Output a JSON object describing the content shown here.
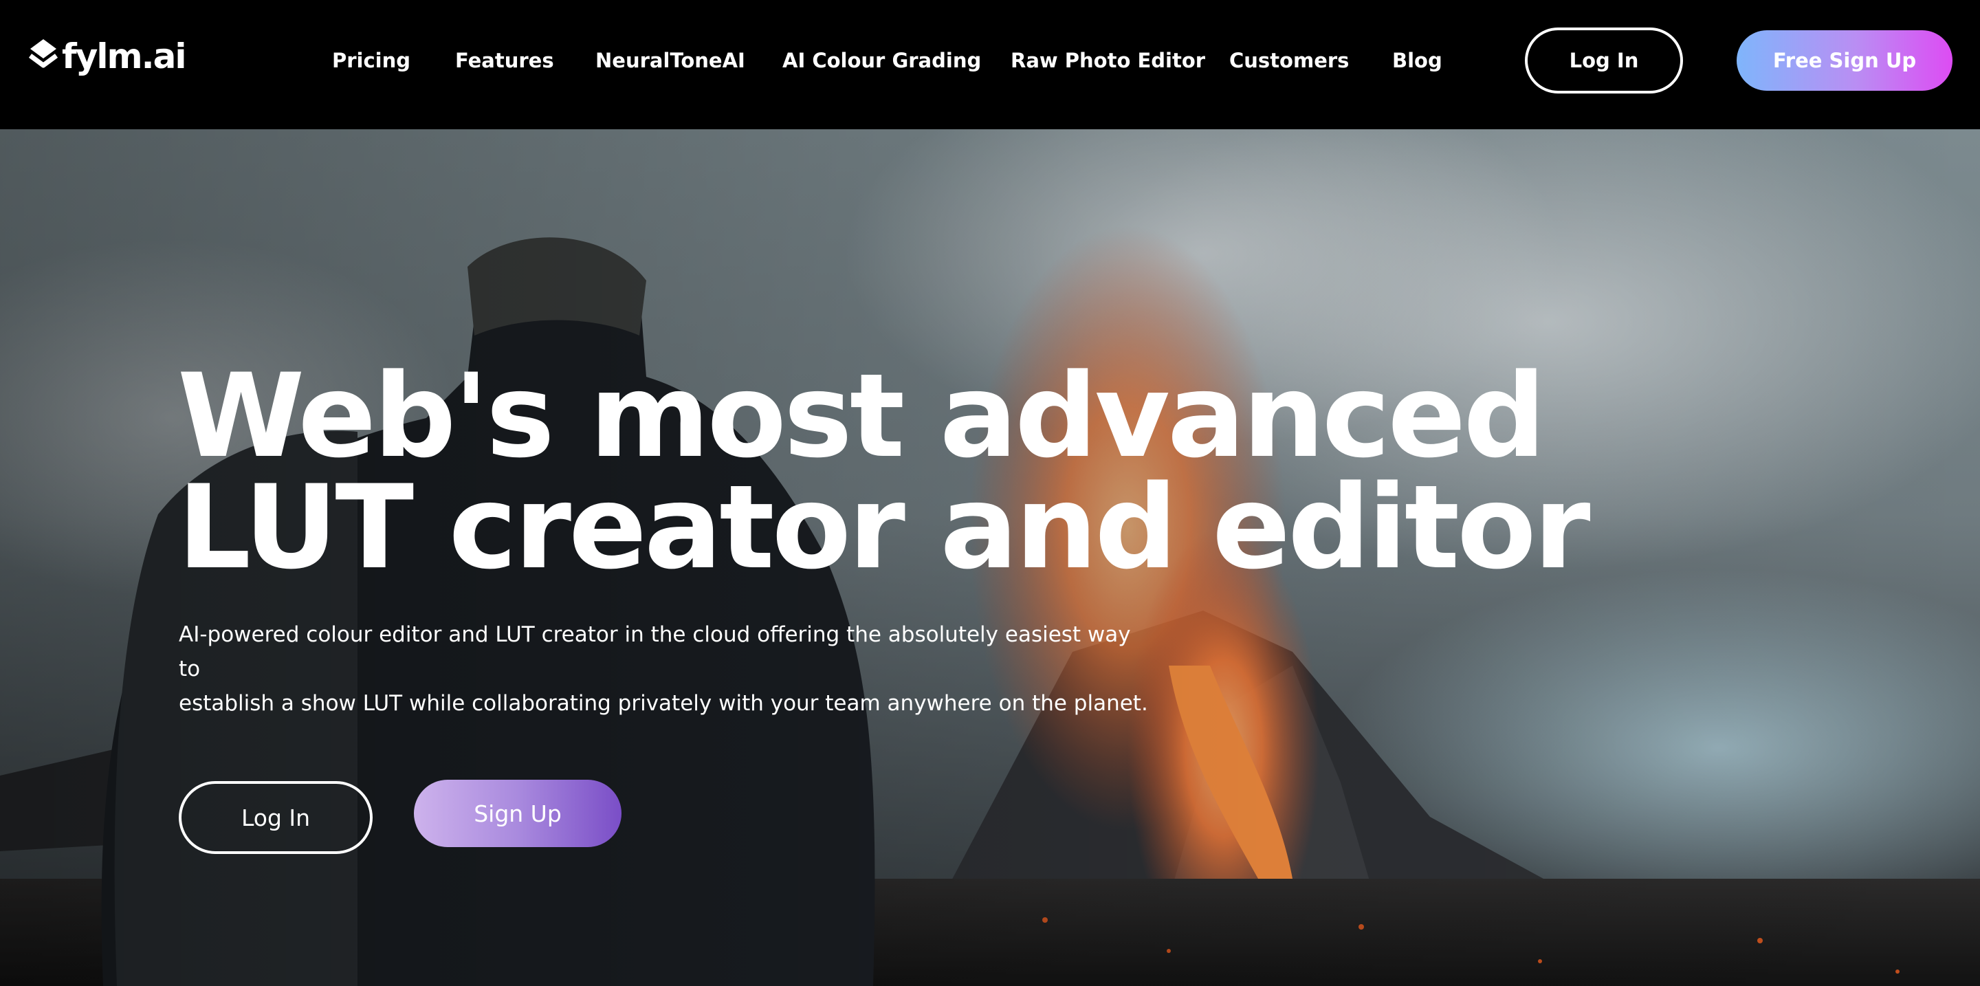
{
  "brand": {
    "logo_icon": "layered-chevron-icon",
    "name": "fylm.ai"
  },
  "nav": {
    "links": [
      {
        "label": "Pricing"
      },
      {
        "label": "Features"
      },
      {
        "label": "NeuralToneAI"
      },
      {
        "label": "AI Colour Grading"
      },
      {
        "label": "Raw Photo Editor"
      },
      {
        "label": "Customers"
      },
      {
        "label": "Blog"
      }
    ],
    "login_label": "Log In",
    "signup_label": "Free Sign Up"
  },
  "hero": {
    "headline_line1": "Web's most advanced",
    "headline_line2": "LUT creator and editor",
    "subtext_line1": "AI-powered colour editor and LUT creator in the cloud offering the absolutely easiest way to",
    "subtext_line2": "establish a show LUT while collaborating privately with your team anywhere on the planet.",
    "login_label": "Log In",
    "signup_label": "Sign Up",
    "background_image": "photographer-filming-erupting-volcano"
  },
  "colors": {
    "nav_background": "#000000",
    "signup_gradient_start": "#7fb5fb",
    "signup_gradient_end": "#dd4cf3",
    "hero_signup_gradient_start": "#cdb2ec",
    "hero_signup_gradient_end": "#7a4ec7",
    "text": "#ffffff"
  }
}
